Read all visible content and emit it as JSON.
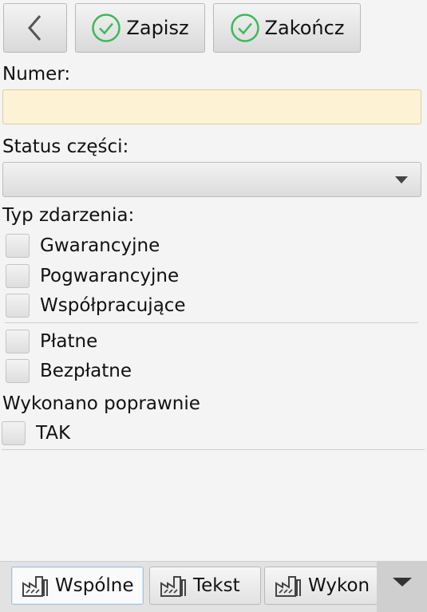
{
  "toolbar": {
    "back_icon": "chevron-left-icon",
    "save_label": "Zapisz",
    "finish_label": "Zakończ",
    "check_icon": "check-circle-icon",
    "check_color": "#3cb95a"
  },
  "form": {
    "numer_label": "Numer:",
    "numer_value": "",
    "status_label": "Status części:",
    "status_value": "",
    "typ_label": "Typ zdarzenia:",
    "typ_options": [
      "Gwarancyjne",
      "Pogwarancyjne",
      "Współpracujące"
    ],
    "payment_options": [
      "Płatne",
      "Bezpłatne"
    ],
    "wykonano_label": "Wykonano poprawnie",
    "tak_label": "TAK"
  },
  "tabs": [
    {
      "label": "Wspólne",
      "icon": "factory-icon",
      "active": true
    },
    {
      "label": "Tekst",
      "icon": "factory-icon",
      "active": false
    },
    {
      "label": "Wykon",
      "icon": "factory-icon",
      "active": false
    }
  ],
  "more_icon": "caret-down-icon"
}
